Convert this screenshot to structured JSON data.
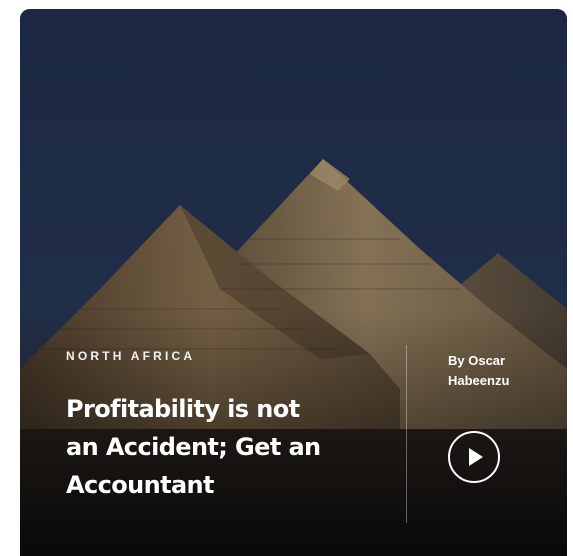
{
  "card": {
    "region": "NORTH AFRICA",
    "title_lines": [
      "Profitability is not",
      "an Accident; Get an",
      "Accountant"
    ],
    "byline_lines": [
      "By Oscar",
      "Habeenzu"
    ],
    "play_icon": "play-icon"
  },
  "colors": {
    "sky": "#1e2a45",
    "text": "#ffffff",
    "stone": "#6b5a44"
  }
}
